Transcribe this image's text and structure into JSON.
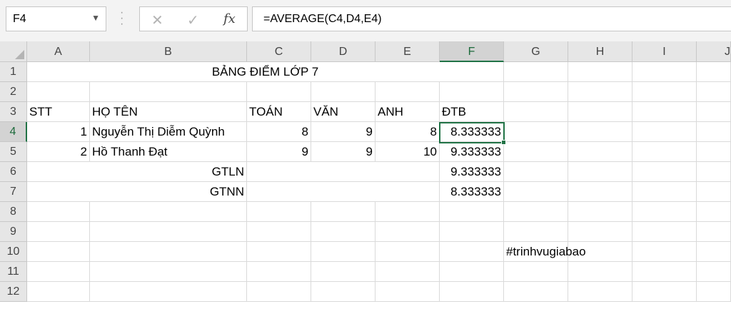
{
  "name_box": {
    "value": "F4"
  },
  "formula_bar": {
    "cancel_icon": "x-icon",
    "enter_icon": "check-icon",
    "fx_label": "fx",
    "formula": "=AVERAGE(C4,D4,E4)"
  },
  "columns": [
    "A",
    "B",
    "C",
    "D",
    "E",
    "F",
    "G",
    "H",
    "I",
    "J"
  ],
  "rows": [
    "1",
    "2",
    "3",
    "4",
    "5",
    "6",
    "7",
    "8",
    "9",
    "10",
    "11",
    "12"
  ],
  "active_cell": "F4",
  "sheet": {
    "title": "BẢNG ĐIỂM LỚP 7",
    "headers": {
      "stt": "STT",
      "name": "HỌ TÊN",
      "math": "TOÁN",
      "lit": "VĂN",
      "eng": "ANH",
      "avg": "ĐTB"
    },
    "students": [
      {
        "stt": "1",
        "name": "Nguyễn Thị Diễm Quỳnh",
        "math": "8",
        "lit": "9",
        "eng": "8",
        "avg": "8.333333"
      },
      {
        "stt": "2",
        "name": "Hồ Thanh Đạt",
        "math": "9",
        "lit": "9",
        "eng": "10",
        "avg": "9.333333"
      }
    ],
    "max_label": "GTLN",
    "max_value": "9.333333",
    "min_label": "GTNN",
    "min_value": "8.333333",
    "hashtag": "#trinhvugiabao"
  },
  "colors": {
    "accent": "#217346",
    "header_bg": "#e6e6e6",
    "grid": "#dadada"
  }
}
